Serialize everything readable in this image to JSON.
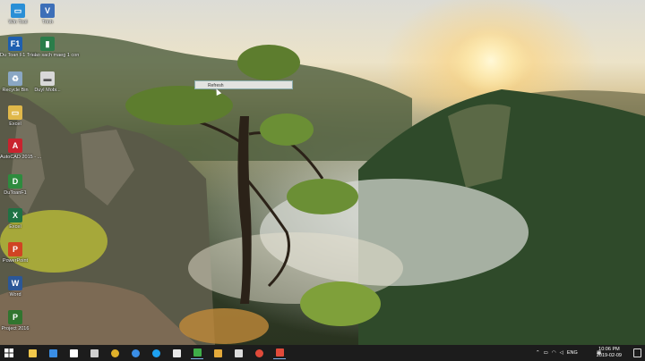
{
  "desktop": {
    "icons": [
      {
        "label": "Win Tool",
        "icon": "computer-icon",
        "color": "#2a8fd6"
      },
      {
        "label": "Trinh",
        "icon": "app-icon",
        "color": "#3d6fb8"
      },
      {
        "label": "Du Toan F1 Trial",
        "icon": "estimate-app-icon",
        "color": "#1e5fb0"
      },
      {
        "label": "cao sach maeg 1 con",
        "icon": "document-icon",
        "color": "#2b7d4a"
      },
      {
        "label": "Recycle Bin",
        "icon": "recycle-bin-icon",
        "color": "#8aa7c4"
      },
      {
        "label": "DuyI Mobi...",
        "icon": "file-icon",
        "color": "#d8d8d8"
      },
      {
        "label": "Excel",
        "icon": "folder-icon",
        "color": "#e0b84a"
      },
      {
        "label": "AutoCAD 2015 - ...",
        "icon": "autocad-icon",
        "color": "#c9232e"
      },
      {
        "label": "DuToanF1",
        "icon": "dutoan-icon",
        "color": "#2e8b3e"
      },
      {
        "label": "Excel",
        "icon": "excel-icon",
        "color": "#1f7244"
      },
      {
        "label": "PowerPoint",
        "icon": "powerpoint-icon",
        "color": "#d04423"
      },
      {
        "label": "Word",
        "icon": "word-icon",
        "color": "#2b5797"
      },
      {
        "label": "Project 2016",
        "icon": "project-icon",
        "color": "#31752f"
      }
    ],
    "rename_box_text": "Refresh"
  },
  "taskbar": {
    "items": [
      {
        "icon": "windows-start-icon",
        "color": "#ffffff"
      },
      {
        "icon": "file-explorer-icon",
        "color": "#f2c84b"
      },
      {
        "icon": "store-icon",
        "color": "#3a8ee6"
      },
      {
        "icon": "mail-icon",
        "color": "#ffffff"
      },
      {
        "icon": "network-icon",
        "color": "#cfcfcf"
      },
      {
        "icon": "chrome-icon",
        "color": "#e0b02a"
      },
      {
        "icon": "edge-icon",
        "color": "#3a8ee6"
      },
      {
        "icon": "skype-icon",
        "color": "#1ea1f1"
      },
      {
        "icon": "media-icon",
        "color": "#e8e8e8"
      },
      {
        "icon": "camtasia-icon",
        "color": "#3fae49"
      },
      {
        "icon": "paint-icon",
        "color": "#e3a93b"
      },
      {
        "icon": "calculator-icon",
        "color": "#dcdcdc"
      },
      {
        "icon": "chrome-icon",
        "color": "#e04a3a"
      },
      {
        "icon": "recorder-icon",
        "color": "#e04a3a"
      }
    ],
    "language": "ENG",
    "time": "10:06 PM",
    "date": "2019-02-09"
  }
}
